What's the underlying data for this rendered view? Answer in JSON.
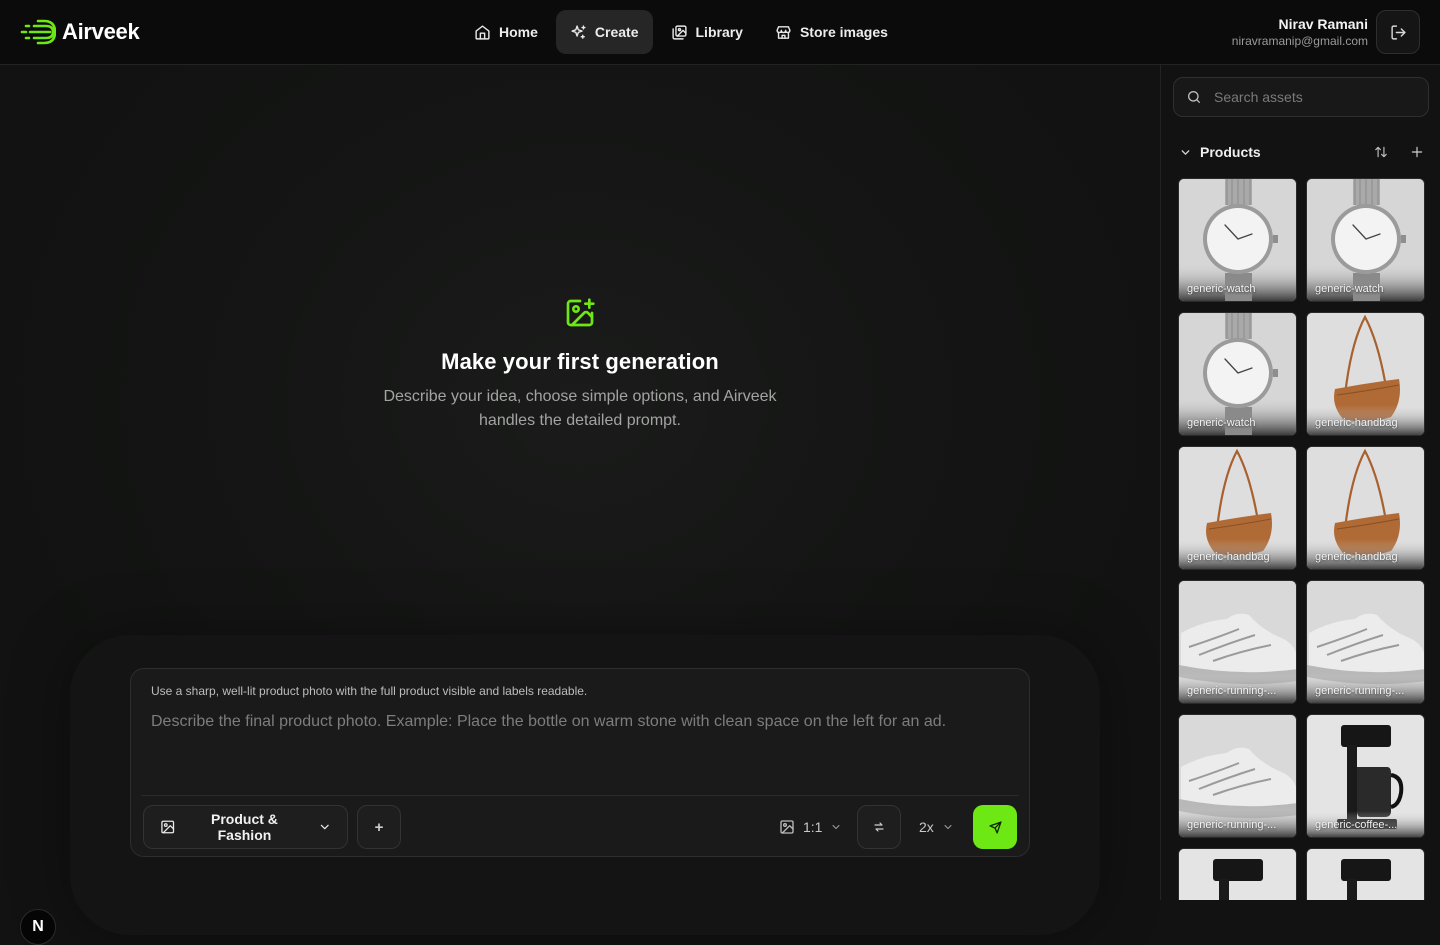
{
  "brand": {
    "name": "Airveek",
    "accent": "#6ee814"
  },
  "nav": {
    "items": [
      {
        "label": "Home",
        "icon": "home-icon",
        "active": false
      },
      {
        "label": "Create",
        "icon": "sparkles-icon",
        "active": true
      },
      {
        "label": "Library",
        "icon": "images-icon",
        "active": false
      },
      {
        "label": "Store images",
        "icon": "store-icon",
        "active": false
      }
    ]
  },
  "user": {
    "name": "Nirav Ramani",
    "email": "niravramanip@gmail.com",
    "logout_icon": "logout-icon"
  },
  "empty_state": {
    "icon": "image-plus-icon",
    "title": "Make your first generation",
    "description": "Describe your idea, choose simple options, and Airveek handles the detailed prompt."
  },
  "composer": {
    "hint": "Use a sharp, well-lit product photo with the full product visible and labels readable.",
    "placeholder": "Describe the final product photo. Example: Place the bottle on warm stone with clean space on the left for an ad.",
    "mode": "Product & Fashion",
    "add_label": "+",
    "ratio": "1:1",
    "scale": "2x"
  },
  "sidebar": {
    "search_placeholder": "Search assets",
    "section_title": "Products",
    "assets": [
      {
        "label": "generic-watch",
        "kind": "watch"
      },
      {
        "label": "generic-watch",
        "kind": "watch"
      },
      {
        "label": "generic-watch",
        "kind": "watch"
      },
      {
        "label": "generic-handbag",
        "kind": "handbag"
      },
      {
        "label": "generic-handbag",
        "kind": "handbag"
      },
      {
        "label": "generic-handbag",
        "kind": "handbag"
      },
      {
        "label": "generic-running-...",
        "kind": "shoe"
      },
      {
        "label": "generic-running-...",
        "kind": "shoe"
      },
      {
        "label": "generic-running-...",
        "kind": "shoe"
      },
      {
        "label": "generic-coffee-...",
        "kind": "coffee"
      },
      {
        "label": "",
        "kind": "coffee"
      },
      {
        "label": "",
        "kind": "coffee"
      }
    ]
  },
  "dev_badge": "N"
}
